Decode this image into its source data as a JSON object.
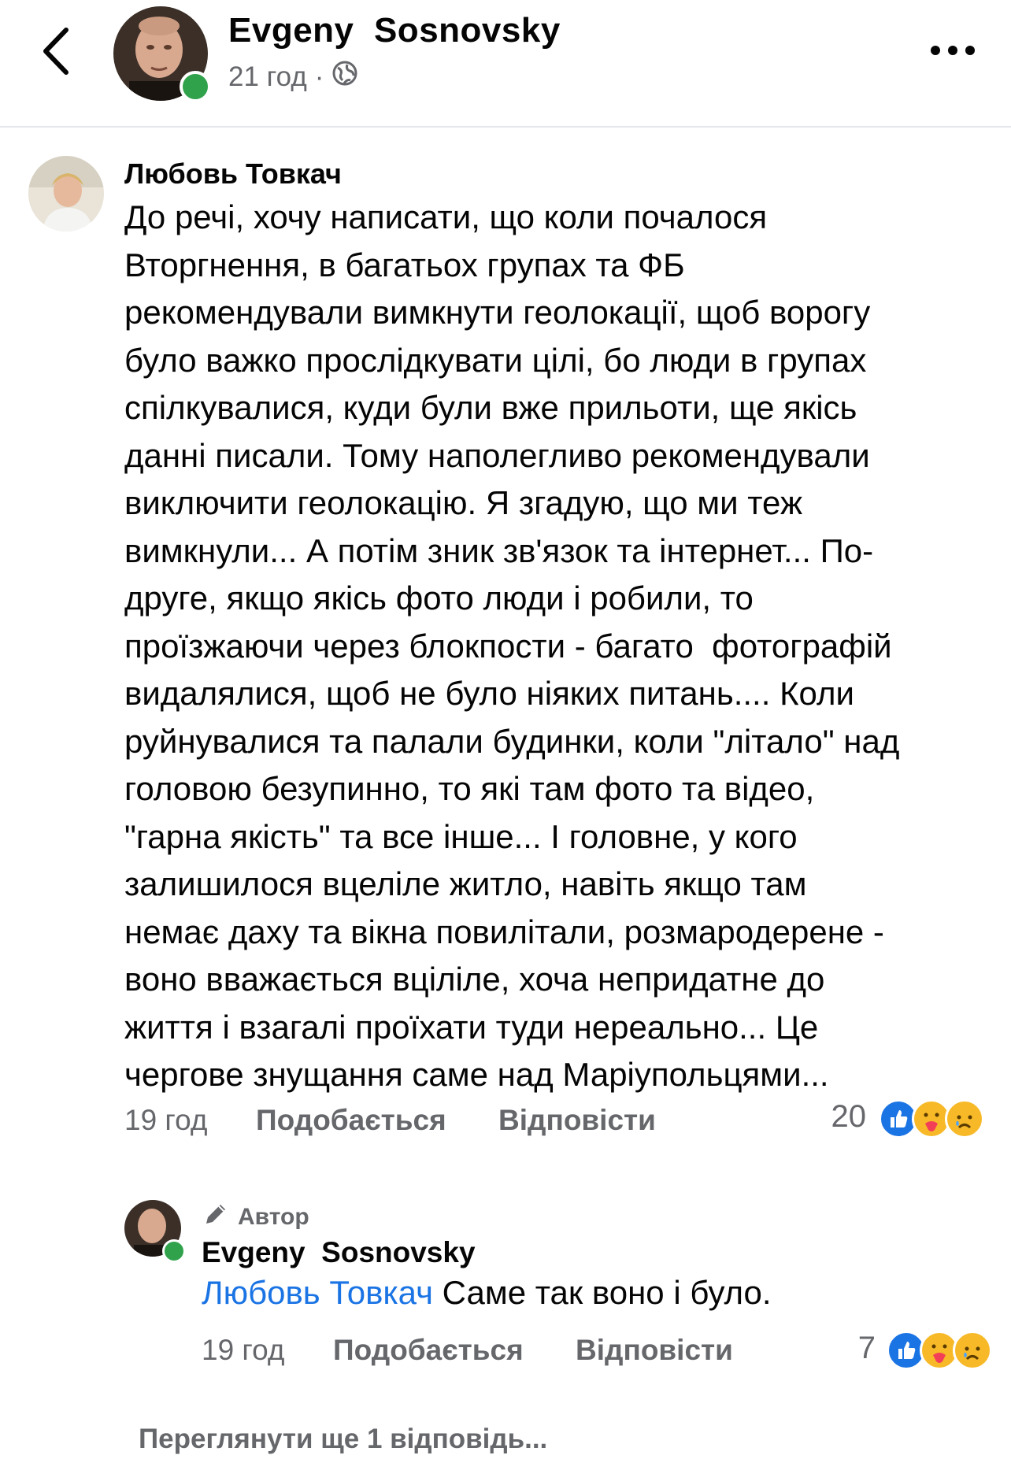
{
  "header": {
    "author_name": "Evgeny  Sosnovsky",
    "time": "21 год",
    "separator": "·",
    "privacy_icon": "globe-icon",
    "back_icon": "chevron-left-icon",
    "more_icon": "more-dots-icon"
  },
  "comment": {
    "author": "Любовь Товкач",
    "lines": [
      "До речі, хочу написати, що коли почалося",
      "Вторгнення, в багатьох групах та ФБ",
      "рекомендували вимкнути геолокації, щоб ворогу",
      "було важко прослідкувати цілі, бо люди в групах",
      "спілкувалися, куди були вже прильоти, ще якісь",
      "данні писали. Тому наполегливо рекомендували",
      "виключити геолокацію. Я згадую, що ми теж",
      "вимкнули... А потім зник зв'язок та інтернет... По-",
      "друге, якщо якісь фото люди і робили, то",
      "проїзжаючи через блокпости - багато  фотографій",
      "видалялися, щоб не було ніяких питань.... Коли",
      "руйнувалися та палали будинки, коли \"літало\" над",
      "головою безупинно, то які там фото та відео,",
      "\"гарна якість\" та все інше... І головне, у кого",
      "залишилося вцеліле житло, навіть якщо там",
      "немає даху та вікна повилітали, розмародерене -",
      "воно вважається вціліле, хоча непридатне до",
      "життя і взагалі проїхати туди нереально... Це",
      "чергове знущання саме над Маріупольцями..."
    ],
    "time": "19 год",
    "like_label": "Подобається",
    "reply_label": "Відповісти",
    "reaction_count": "20",
    "reactions": [
      "like-icon",
      "care-icon",
      "sad-icon"
    ]
  },
  "reply": {
    "badge_icon": "pencil-icon",
    "badge_label": "Автор",
    "author": "Evgeny  Sosnovsky",
    "mention": "Любовь Товкач",
    "text": " Саме так воно і було.",
    "time": "19 год",
    "like_label": "Подобається",
    "reply_label": "Відповісти",
    "reaction_count": "7",
    "reactions": [
      "like-icon",
      "care-icon",
      "sad-icon"
    ]
  },
  "view_more_label": "Переглянути ще 1 відповідь...",
  "colors": {
    "online": "#31a24c",
    "like_blue": "#1b74e4",
    "muted": "#65676b",
    "care_red": "#f33e58",
    "emoji_yellow": "#f7b928"
  }
}
